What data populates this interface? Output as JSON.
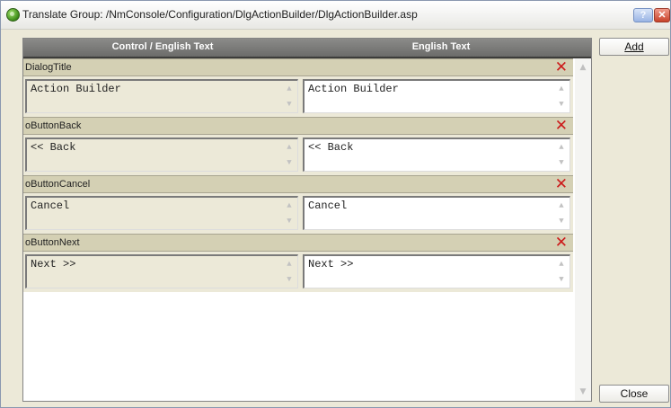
{
  "window": {
    "title": "Translate Group: /NmConsole/Configuration/DlgActionBuilder/DlgActionBuilder.asp",
    "help_label": "?",
    "close_label": "✕"
  },
  "grid": {
    "columns": [
      "Control / English Text",
      "English Text"
    ],
    "groups": [
      {
        "name": "DialogTitle",
        "source": "Action Builder",
        "translation": "Action Builder"
      },
      {
        "name": "oButtonBack",
        "source": "<< Back",
        "translation": "<< Back"
      },
      {
        "name": "oButtonCancel",
        "source": "Cancel",
        "translation": "Cancel"
      },
      {
        "name": "oButtonNext",
        "source": "Next >>",
        "translation": "Next >>"
      }
    ],
    "delete_glyph": "✕",
    "scroll_up_glyph": "▲",
    "scroll_down_glyph": "▼"
  },
  "buttons": {
    "add_label": "Add",
    "close_label": "Close"
  },
  "icons": {
    "app": "green-globe-icon",
    "delete": "red-x-icon"
  },
  "colors": {
    "group_row": "#d4d0b4",
    "header": "#7a7a78",
    "delete": "#cc1a1a"
  }
}
